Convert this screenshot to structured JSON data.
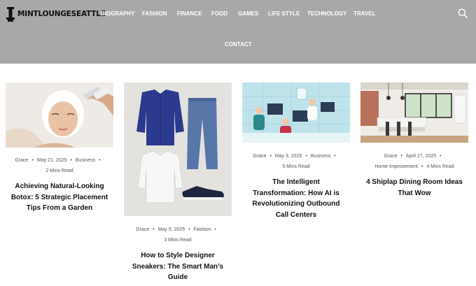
{
  "site": {
    "logo_text": "MINTLOUNGESEATTLE"
  },
  "nav": {
    "items": [
      "BIOGRAPHY",
      "FASHION",
      "FINANCE",
      "FOOD",
      "GAMES",
      "LIFE STYLE",
      "TECHNOLOGY",
      "TRAVEL"
    ],
    "contact": "CONTACT"
  },
  "posts": [
    {
      "author": "Grace",
      "date": "May 21, 2025",
      "category": "Business",
      "read_time": "2 Mins Read",
      "title": "Achieving Natural-Looking Botox: 5 Strategic Placement Tips From a Garden"
    },
    {
      "author": "Grace",
      "date": "May 5, 2025",
      "category": "Fashion",
      "read_time": "3 Mins Read",
      "title": "How to Style Designer Sneakers: The Smart Man’s Guide"
    },
    {
      "author": "Grace",
      "date": "May 3, 2025",
      "category": "Business",
      "read_time": "5 Mins Read",
      "title": "The Intelligent Transformation: How AI is Revolutionizing Outbound Call Centers"
    },
    {
      "author": "Grace",
      "date": "April 27, 2025",
      "category": "Home Improvement",
      "read_time": "4 Mins Read",
      "title": "4 Shiplap Dining Room Ideas That Wow"
    }
  ],
  "icons": {
    "search": "search-icon",
    "logo": "logo-icon"
  },
  "colors": {
    "header_bg": "#a8a8a8",
    "nav_text": "#ffffff",
    "title_text": "#111111",
    "meta_text": "#555555"
  }
}
